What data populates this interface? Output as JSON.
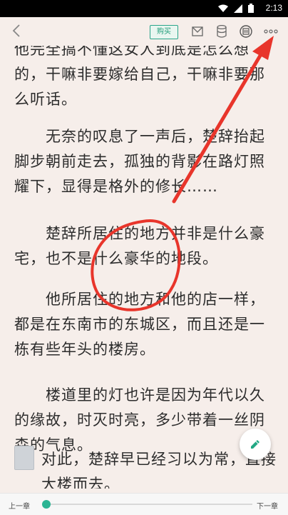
{
  "status": {
    "time": "2:13"
  },
  "toolbar": {
    "buy_label": "购买"
  },
  "paragraphs": [
    "他完全搞不懂这女人到底是怎么想的，干嘛非要嫁给自己，干嘛非要那么听话。",
    "　　无奈的叹息了一声后，楚辞抬起脚步朝前走去，孤独的背影在路灯照耀下，显得是格外的修长……",
    "　　楚辞所居住的地方并非是什么豪宅，也不是什么豪华的地段。",
    "　　他所居住的地方和他的店一样，都是在东南市的东城区，而且还是一栋有些年头的楼房。",
    "　　楼道里的灯也许是因为年代以久的缘故，时灭时亮，多少带着一丝阴森的气息。",
    "对此，楚辞早已经习以为常，直接大楼而去。"
  ],
  "bottom": {
    "prev_label": "上一章",
    "next_label": "下一章",
    "progress": 0.01
  },
  "colors": {
    "accent": "#2bb493",
    "annotation": "#e8352b",
    "background": "#f6eeea"
  },
  "icons": [
    "back-icon",
    "message-icon",
    "database-icon",
    "tts-icon",
    "more-icon",
    "pencil-icon",
    "wifi-icon",
    "signal-icon",
    "battery-icon"
  ]
}
